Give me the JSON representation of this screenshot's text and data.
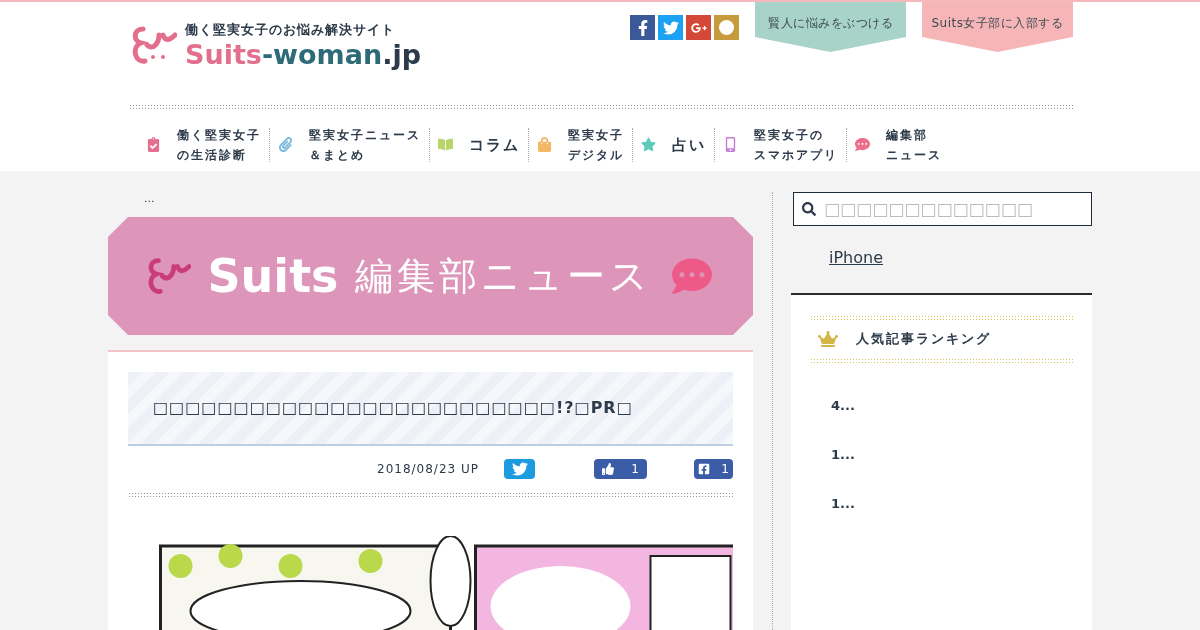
{
  "header": {
    "tagline": "働く堅実女子のお悩み解決サイト",
    "logo_main": "Suits",
    "logo_dash": "-woman",
    "logo_tld": ".jp",
    "buttons": [
      {
        "label": "賢人に悩みをぶつける",
        "color": "#a7d3c9"
      },
      {
        "label": "Suits女子部に入部する",
        "color": "#f6b6b8"
      }
    ]
  },
  "nav": [
    {
      "lines": [
        "働く堅実女子",
        "の生活診断"
      ],
      "kind": "clipboard"
    },
    {
      "lines": [
        "堅実女子ニュース",
        "＆まとめ"
      ],
      "kind": "clip"
    },
    {
      "lines": [
        "コラム"
      ],
      "kind": "book"
    },
    {
      "lines": [
        "堅実女子",
        "デジタル"
      ],
      "kind": "bag"
    },
    {
      "lines": [
        "占い"
      ],
      "kind": "star"
    },
    {
      "lines": [
        "堅実女子の",
        "スマホアプリ"
      ],
      "kind": "phone"
    },
    {
      "lines": [
        "編集部",
        "ニュース"
      ],
      "kind": "chat"
    }
  ],
  "breadcrumb": "...",
  "banner": {
    "brand": "Suits",
    "title": "編集部ニュース"
  },
  "article": {
    "title": "□□□□□□□□□□□□□□□□□□□□□□□□□!?□PR□",
    "date": "2018/08/23 UP",
    "like_count": "1",
    "share_count": "1"
  },
  "sidebar": {
    "search_placeholder": "□□□□□□□□□□□□□",
    "link": "iPhone",
    "ranking_title": "人気記事ランキング",
    "ranking": [
      "4...",
      "1...",
      "1..."
    ]
  }
}
